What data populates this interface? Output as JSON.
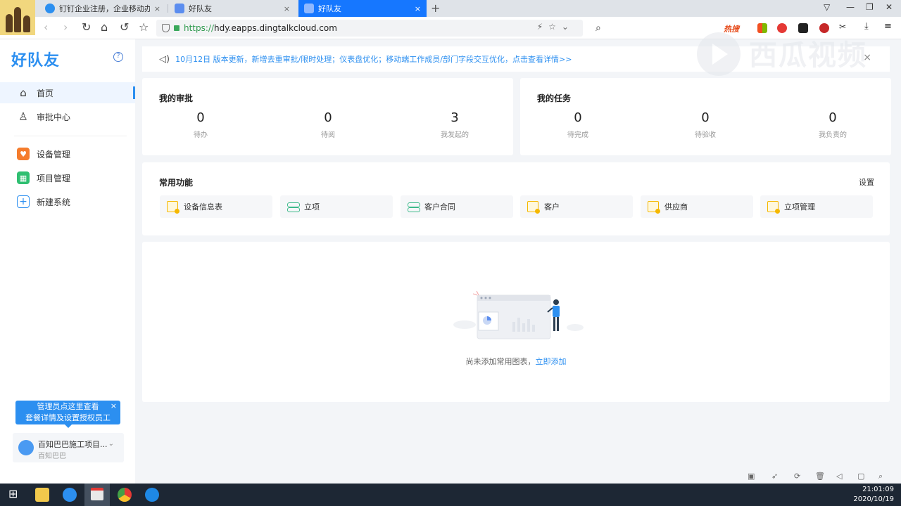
{
  "browser": {
    "tabs": [
      {
        "label": "钉钉企业注册，企业移动办公...",
        "close": "×"
      },
      {
        "label": "好队友",
        "close": "×"
      },
      {
        "label": "好队友",
        "close": "×"
      }
    ],
    "new_tab": "+",
    "url_prefix": "https://",
    "url_rest": "hdy.eapps.dingtalkcloud.com",
    "search_placeholder": "",
    "hot_search": "热搜"
  },
  "watermark": {
    "text": "西瓜视频"
  },
  "sidebar": {
    "logo": "好队友",
    "help": "?",
    "items": [
      {
        "label": "首页"
      },
      {
        "label": "审批中心"
      },
      {
        "label": "设备管理"
      },
      {
        "label": "项目管理"
      },
      {
        "label": "新建系统"
      }
    ],
    "admin_tip_line1": "管理员点这里查看",
    "admin_tip_line2": "套餐详情及设置授权员工",
    "admin_tip_close": "×",
    "user_name": "百知巴巴施工项目...",
    "user_org": "百知巴巴"
  },
  "notice": {
    "text": "10月12日 版本更新，新增去重审批/限时处理；仪表盘优化；移动端工作成员/部门字段交互优化，点击查看详情>>",
    "close": "×"
  },
  "approval": {
    "title": "我的审批",
    "stats": [
      {
        "value": "0",
        "label": "待办"
      },
      {
        "value": "0",
        "label": "待阅"
      },
      {
        "value": "3",
        "label": "我发起的"
      }
    ]
  },
  "tasks": {
    "title": "我的任务",
    "stats": [
      {
        "value": "0",
        "label": "待完成"
      },
      {
        "value": "0",
        "label": "待验收"
      },
      {
        "value": "0",
        "label": "我负责的"
      }
    ]
  },
  "functions": {
    "title": "常用功能",
    "settings": "设置",
    "items": [
      {
        "label": "设备信息表",
        "icon": "doc"
      },
      {
        "label": "立项",
        "icon": "flow"
      },
      {
        "label": "客户合同",
        "icon": "flow"
      },
      {
        "label": "客户",
        "icon": "doc"
      },
      {
        "label": "供应商",
        "icon": "doc"
      },
      {
        "label": "立项管理",
        "icon": "doc"
      }
    ]
  },
  "charts": {
    "empty_text": "尚未添加常用图表，",
    "add_link": "立即添加"
  },
  "taskbar": {
    "time": "21:01:09",
    "date": "2020/10/19"
  }
}
